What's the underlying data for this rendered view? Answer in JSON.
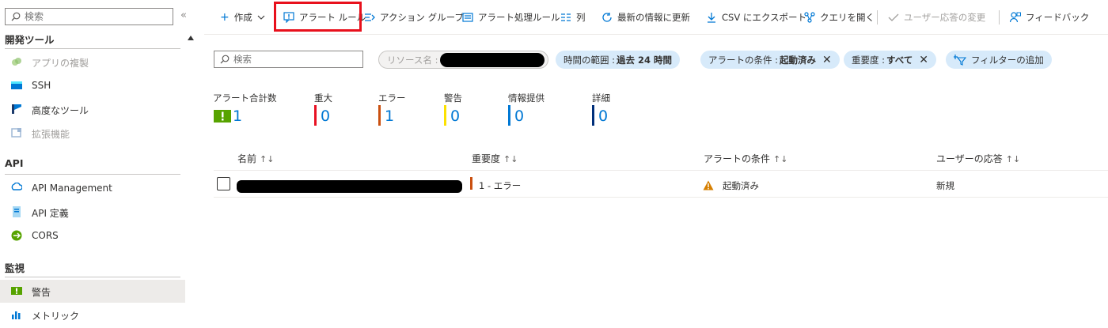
{
  "sidebar": {
    "search_placeholder": "検索",
    "collapse_glyph": "«",
    "sections": [
      {
        "title": "開発ツール"
      },
      {
        "title": "API"
      },
      {
        "title": "監視"
      }
    ],
    "items": [
      {
        "label": "アプリの複製",
        "icon": "clone-app-icon",
        "disabled": true
      },
      {
        "label": "SSH",
        "icon": "ssh-terminal-icon"
      },
      {
        "label": "高度なツール",
        "icon": "advanced-tools-icon"
      },
      {
        "label": "拡張機能",
        "icon": "extensions-icon",
        "disabled": true
      },
      {
        "label": "API Management",
        "icon": "api-management-icon"
      },
      {
        "label": "API 定義",
        "icon": "api-definition-icon"
      },
      {
        "label": "CORS",
        "icon": "cors-icon"
      },
      {
        "label": "警告",
        "icon": "alert-icon",
        "active": true
      },
      {
        "label": "メトリック",
        "icon": "metrics-icon"
      }
    ]
  },
  "toolbar": {
    "create": "作成",
    "alert_rules": "アラート ルール",
    "action_groups": "アクション グループ",
    "alert_processing_rules": "アラート処理ルール",
    "columns": "列",
    "refresh": "最新の情報に更新",
    "export_csv": "CSV にエクスポート",
    "open_query": "クエリを開く",
    "change_user_response": "ユーザー応答の変更",
    "feedback": "フィードバック"
  },
  "filters": {
    "search_placeholder": "検索",
    "resource_label": "リソース名 :",
    "time_range_label": "時間の範囲 :",
    "time_range_value": "過去 24 時間",
    "alert_condition_label": "アラートの条件 :",
    "alert_condition_value": "起動済み",
    "severity_label": "重要度 :",
    "severity_value": "すべて",
    "add_filter": "フィルターの追加"
  },
  "summary": [
    {
      "label": "アラート合計数",
      "value": "1",
      "color": "#57a300"
    },
    {
      "label": "重大",
      "value": "0",
      "color": "#e81123"
    },
    {
      "label": "エラー",
      "value": "1",
      "color": "#ca5010"
    },
    {
      "label": "警告",
      "value": "0",
      "color": "#fce100"
    },
    {
      "label": "情報提供",
      "value": "0",
      "color": "#0078d4"
    },
    {
      "label": "詳細",
      "value": "0",
      "color": "#002f7a"
    }
  ],
  "table": {
    "columns": [
      "名前",
      "重要度",
      "アラートの条件",
      "ユーザーの応答"
    ],
    "sort_glyph": "↑↓",
    "rows": [
      {
        "severity": "1 - エラー",
        "condition": "起動済み",
        "user_response": "新規"
      }
    ]
  },
  "colors": {
    "accent": "#0078d4",
    "highlight": "#e8101c",
    "warning": "#d67f00",
    "error": "#ca5010"
  }
}
